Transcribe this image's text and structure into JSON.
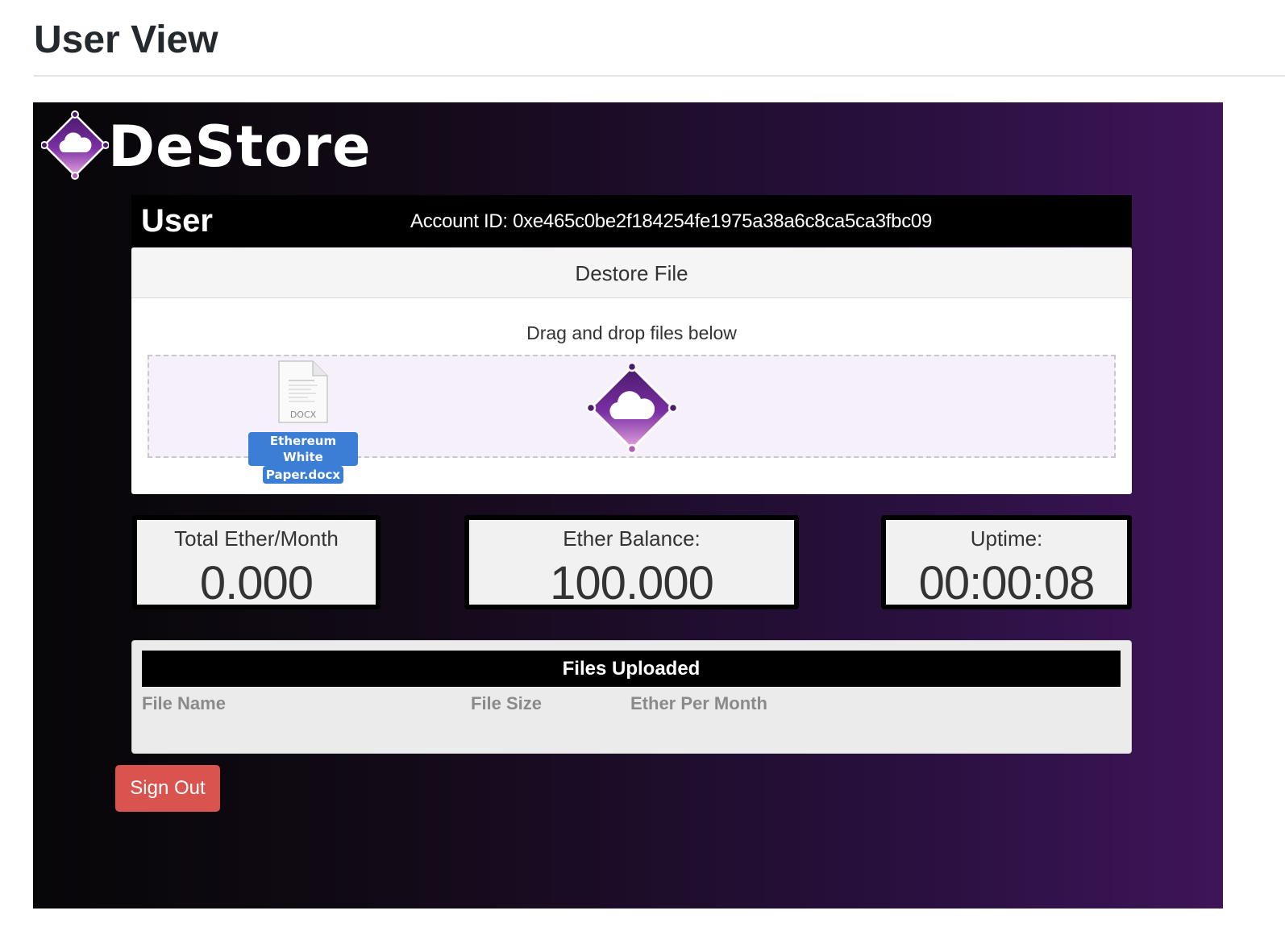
{
  "page": {
    "heading": "User View"
  },
  "brand": {
    "name": "DeStore",
    "logo_icon": "destore-cloud-diamond-icon",
    "accent_color": "#7b2fa3"
  },
  "user_bar": {
    "title": "User",
    "account_id": "Account ID: 0xe465c0be2f184254fe1975a38a6c8ca5ca3fbc09"
  },
  "upload": {
    "panel_title": "Destore File",
    "drag_hint": "Drag and drop files below",
    "dragged_file": {
      "name_line1": "Ethereum White",
      "name_line2": "Paper.docx",
      "type_label": "DOCX",
      "icon": "docx-file-icon"
    },
    "drop_icon": "destore-cloud-diamond-icon"
  },
  "stats": [
    {
      "label": "Total Ether/Month",
      "value": "0.000"
    },
    {
      "label": "Ether Balance:",
      "value": "100.000"
    },
    {
      "label": "Uptime:",
      "value": "00:00:08"
    }
  ],
  "files_uploaded": {
    "title": "Files Uploaded",
    "columns": [
      "File Name",
      "File Size",
      "Ether Per Month"
    ],
    "rows": []
  },
  "sign_out_label": "Sign Out"
}
